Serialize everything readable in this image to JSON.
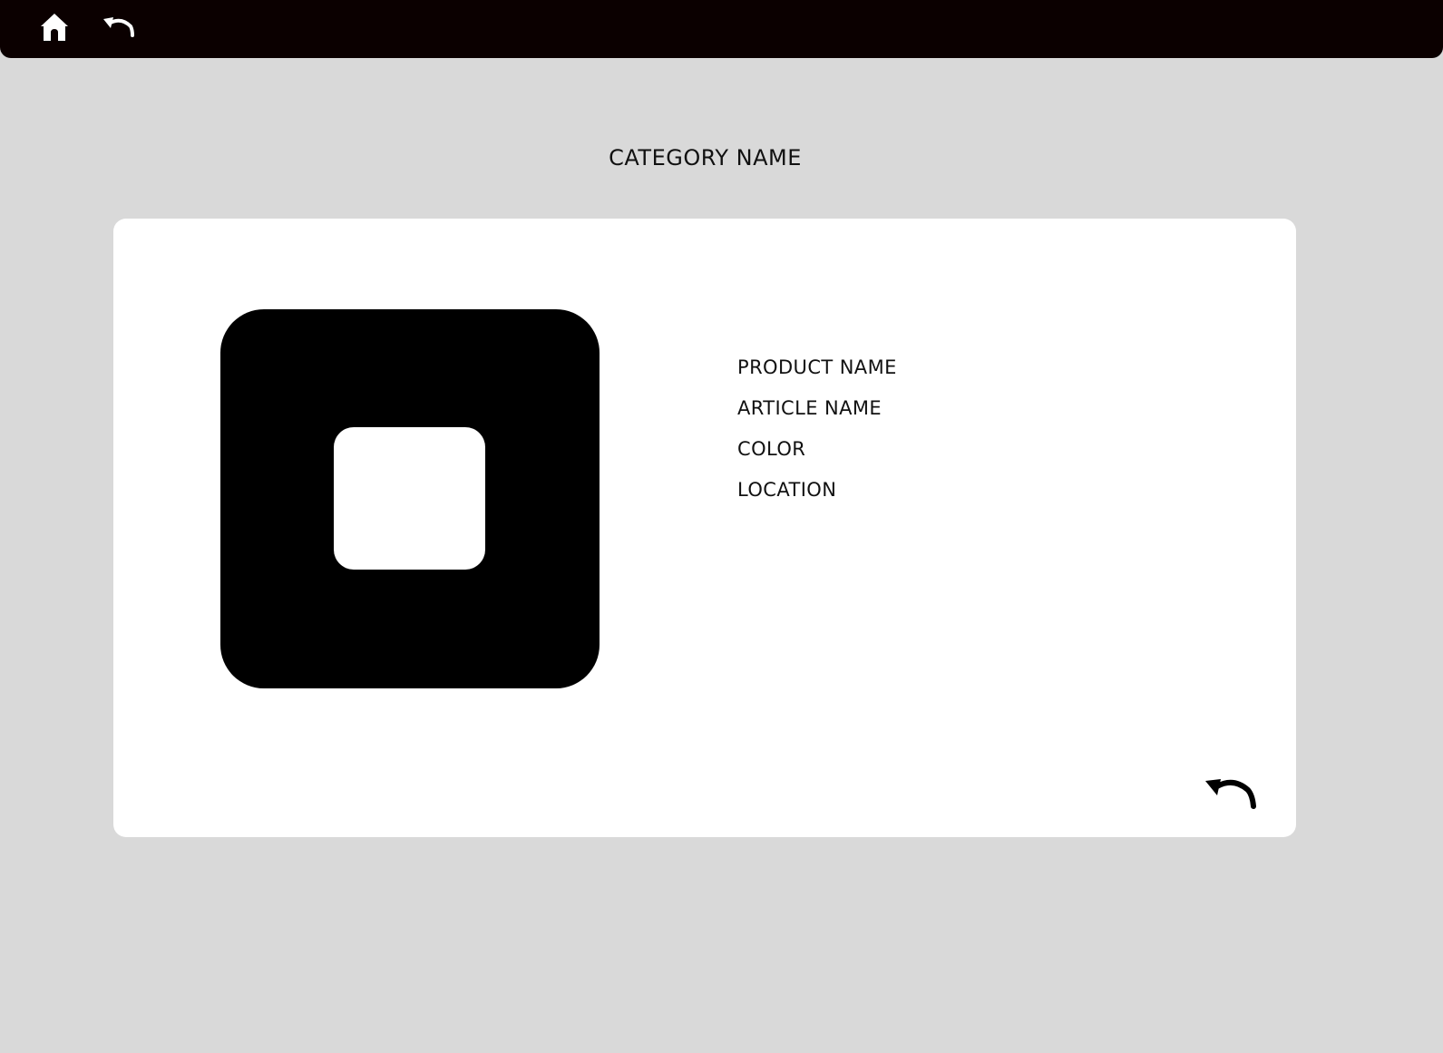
{
  "topbar": {
    "home_icon": "home-icon",
    "back_icon": "undo-arrow-icon",
    "background_color": "#0b0000",
    "icon_color": "#ffffff"
  },
  "page": {
    "category_title": "CATEGORY NAME",
    "background_color": "#d9d9d9"
  },
  "product": {
    "image_icon": "image-placeholder-icon",
    "details": [
      "PRODUCT NAME",
      "ARTICLE NAME",
      "COLOR",
      "LOCATION"
    ],
    "back_icon": "undo-arrow-icon"
  }
}
